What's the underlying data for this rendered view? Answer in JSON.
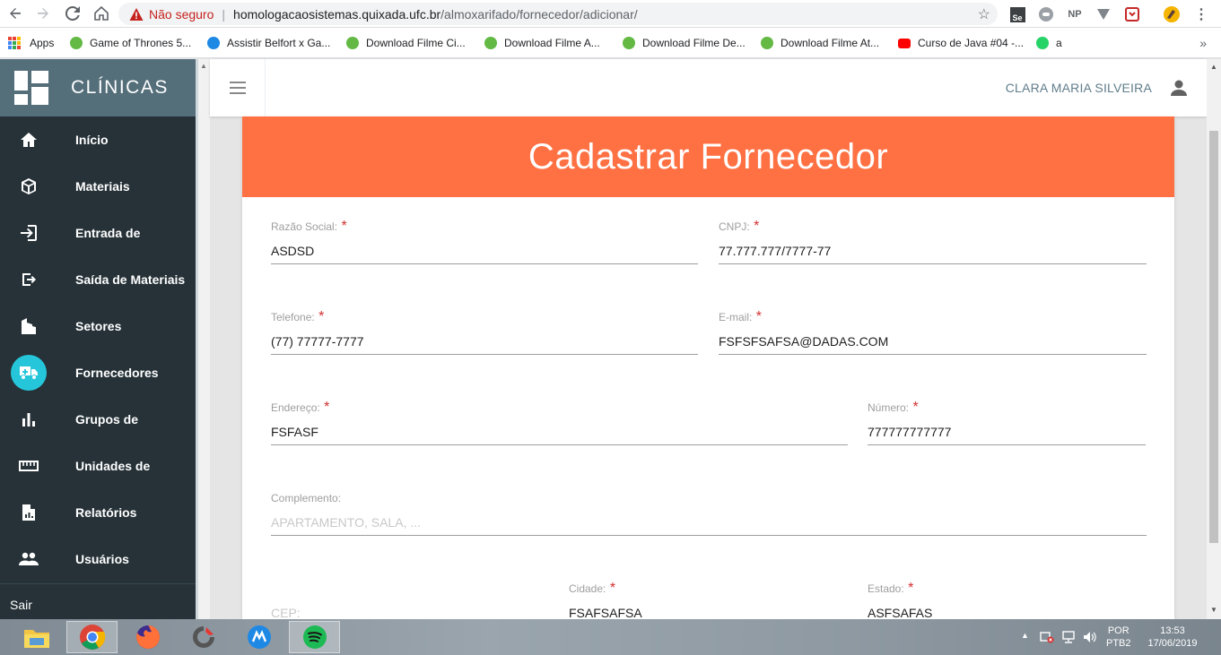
{
  "browser": {
    "insecure_label": "Não seguro",
    "url_domain": "homologacaosistemas.quixada.ufc.br",
    "url_path": "/almoxarifado/fornecedor/adicionar/",
    "extensions": [
      "Se",
      "NP"
    ]
  },
  "bookmarks": [
    {
      "label": "Apps",
      "icon": "apps-grid-icon"
    },
    {
      "label": "Game of Thrones 5...",
      "icon": "utorrent-icon"
    },
    {
      "label": "Assistir Belfort x Ga...",
      "icon": "globe-icon"
    },
    {
      "label": "Download Filme Ci...",
      "icon": "utorrent-icon"
    },
    {
      "label": "Download Filme A...",
      "icon": "utorrent-icon"
    },
    {
      "label": "Download Filme De...",
      "icon": "utorrent-icon"
    },
    {
      "label": "Download Filme At...",
      "icon": "utorrent-icon"
    },
    {
      "label": "Curso de Java #04 -...",
      "icon": "youtube-icon"
    },
    {
      "label": "a",
      "icon": "whatsapp-icon"
    }
  ],
  "sidebar": {
    "brand": "CLÍNICAS",
    "items": [
      {
        "label": "Início",
        "icon": "home-icon"
      },
      {
        "label": "Materiais",
        "icon": "box-icon"
      },
      {
        "label": "Entrada de",
        "icon": "login-icon"
      },
      {
        "label": "Saída de Materiais",
        "icon": "logout-icon"
      },
      {
        "label": "Setores",
        "icon": "building-icon"
      },
      {
        "label": "Fornecedores",
        "icon": "truck-icon"
      },
      {
        "label": "Grupos de",
        "icon": "bar-chart-icon"
      },
      {
        "label": "Unidades de",
        "icon": "ruler-icon"
      },
      {
        "label": "Relatórios",
        "icon": "report-icon"
      },
      {
        "label": "Usuários",
        "icon": "people-icon"
      }
    ],
    "active_index": 5,
    "logout_label": "Sair"
  },
  "topbar": {
    "user_name": "CLARA MARIA SILVEIRA"
  },
  "form": {
    "title": "Cadastrar Fornecedor",
    "razao_social": {
      "label": "Razão Social:",
      "value": "ASDSD"
    },
    "cnpj": {
      "label": "CNPJ:",
      "value": "77.777.777/7777-77"
    },
    "telefone": {
      "label": "Telefone:",
      "value": "(77) 77777-7777"
    },
    "email": {
      "label": "E-mail:",
      "value": "FSFSFSAFSA@DADAS.COM"
    },
    "endereco": {
      "label": "Endereço:",
      "value": "FSFASF"
    },
    "numero": {
      "label": "Número:",
      "value": "777777777777"
    },
    "complemento": {
      "label": "Complemento:",
      "value": "",
      "placeholder": "APARTAMENTO, SALA, ..."
    },
    "cep": {
      "label": "",
      "value": "",
      "placeholder": "CEP:"
    },
    "cidade": {
      "label": "Cidade:",
      "value": "FSAFSAFSA"
    },
    "estado": {
      "label": "Estado:",
      "value": "ASFSAFAS"
    },
    "required_mark": "*"
  },
  "taskbar": {
    "apps": [
      "file-explorer-icon",
      "chrome-icon",
      "firefox-icon",
      "app-icon",
      "app-icon",
      "spotify-icon"
    ],
    "lang_line1": "POR",
    "lang_line2": "PTB2",
    "time": "13:53",
    "date": "17/06/2019"
  },
  "colors": {
    "sidebar_bg": "#263238",
    "sidebar_header": "#546e7a",
    "accent_cyan": "#26c6da",
    "card_header": "#ff7043",
    "required": "#d32f2f"
  }
}
